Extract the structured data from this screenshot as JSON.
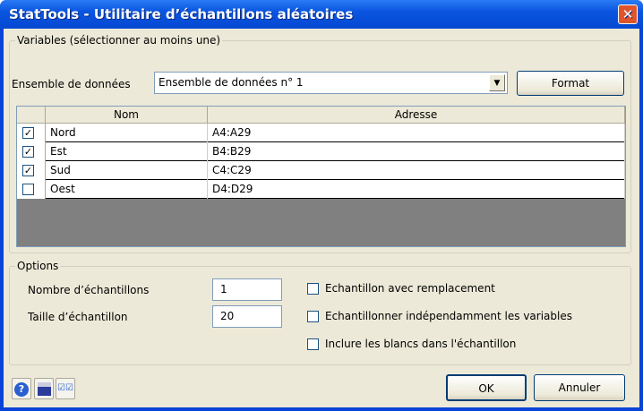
{
  "window": {
    "title": "StatTools - Utilitaire d’échantillons aléatoires",
    "close": "✕"
  },
  "variables": {
    "group_label": "Variables (sélectionner au moins une)",
    "dataset_label": "Ensemble de données",
    "dataset_value": "Ensemble de données n° 1",
    "format_button": "Format",
    "columns": [
      "Nom",
      "Adresse"
    ],
    "rows": [
      {
        "name": "Nord",
        "address": "A4:A29",
        "checked": true
      },
      {
        "name": "Est",
        "address": "B4:B29",
        "checked": true
      },
      {
        "name": "Sud",
        "address": "C4:C29",
        "checked": true
      },
      {
        "name": "Oest",
        "address": "D4:D29",
        "checked": false
      }
    ]
  },
  "options": {
    "group_label": "Options",
    "num_samples_label": "Nombre d’échantillons",
    "num_samples": "1",
    "sample_size_label": "Taille d’échantillon",
    "sample_size": "20",
    "checkboxes": [
      {
        "label": "Echantillon avec remplacement",
        "checked": false
      },
      {
        "label": "Echantillonner indépendamment les variables",
        "checked": false
      },
      {
        "label": "Inclure les blancs dans l'échantillon",
        "checked": false
      }
    ]
  },
  "footer": {
    "ok": "OK",
    "cancel": "Annuler"
  }
}
